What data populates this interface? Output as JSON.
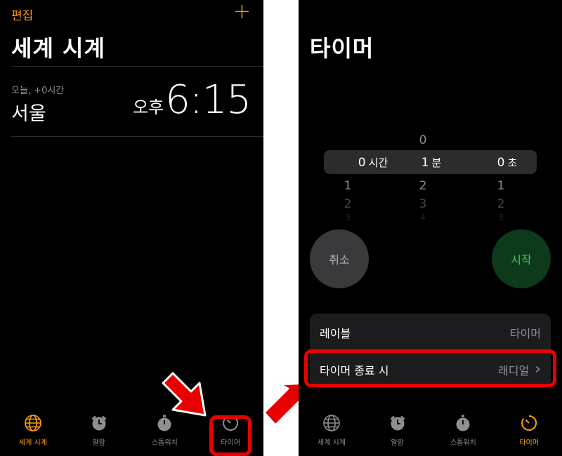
{
  "left": {
    "edit_label": "편집",
    "add_label": "+",
    "title": "세계 시계",
    "clock": {
      "offset": "오늘, +0시간",
      "city": "서울",
      "ampm": "오후",
      "time": "6:15"
    }
  },
  "right": {
    "title": "타이머",
    "picker": {
      "above": [
        "",
        "0",
        ""
      ],
      "selected": [
        {
          "value": "0",
          "unit": "시간"
        },
        {
          "value": "1",
          "unit": "분"
        },
        {
          "value": "0",
          "unit": "초"
        }
      ],
      "below1": [
        "1",
        "2",
        "1"
      ],
      "below2": [
        "2",
        "3",
        "2"
      ],
      "below3": [
        "3",
        "4",
        "3"
      ]
    },
    "cancel_label": "취소",
    "start_label": "시작",
    "settings": [
      {
        "label": "레이블",
        "value": "타이머"
      },
      {
        "label": "타이머 종료 시",
        "value": "래디얼"
      }
    ],
    "chevron": "›"
  },
  "tabs": [
    {
      "label": "세계 시계",
      "icon": "globe-icon"
    },
    {
      "label": "알람",
      "icon": "alarm-clock-icon"
    },
    {
      "label": "스톱워치",
      "icon": "stopwatch-icon"
    },
    {
      "label": "타이머",
      "icon": "timer-icon"
    }
  ],
  "colors": {
    "accent": "#ff9f0a",
    "start_green": "#30d158",
    "highlight_red": "#e80000",
    "background": "#000000"
  }
}
